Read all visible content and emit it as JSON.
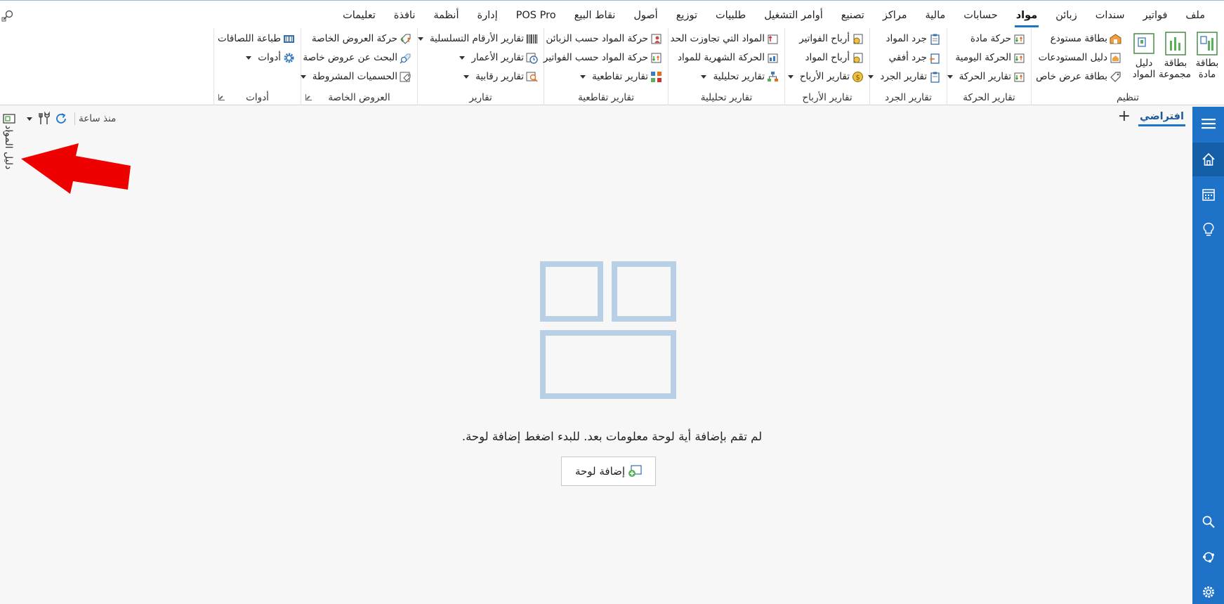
{
  "menu": {
    "items": [
      "ملف",
      "فواتير",
      "سندات",
      "زبائن",
      "مواد",
      "حسابات",
      "مالية",
      "مراكز",
      "تصنيع",
      "أوامر التشغيل",
      "طلبيات",
      "توزيع",
      "أصول",
      "نقاط البيع",
      "POS Pro",
      "إدارة",
      "أنظمة",
      "نافذة",
      "تعليمات"
    ],
    "active": "مواد"
  },
  "ribbon": {
    "setup": {
      "label": "تنظيم",
      "item_card": "بطاقة مادة",
      "group_card": "بطاقة مجموعة",
      "items_guide": "دليل المواد",
      "warehouse_card": "بطاقة مستودع",
      "warehouses_guide": "دليل المستودعات",
      "special_offer_card": "بطاقة عرض خاص"
    },
    "movement": {
      "label": "تقارير الحركة",
      "item_movement": "حركة مادة",
      "daily_movement": "الحركة اليومية",
      "movement_reports": "تقارير الحركة"
    },
    "inventory": {
      "label": "تقارير الجرد",
      "items_inventory": "جرد المواد",
      "horizontal_inventory": "جرد أفقي",
      "inventory_reports": "تقارير الجرد"
    },
    "profits": {
      "label": "تقارير الأرباح",
      "invoice_profits": "أرباح الفواتير",
      "item_profits": "أرباح المواد",
      "profit_reports": "تقارير الأرباح"
    },
    "analytic": {
      "label": "تقارير تحليلية",
      "over_limit": "المواد التي تجاوزت الحد",
      "monthly_movement": "الحركة الشهرية للمواد",
      "analytic_reports": "تقارير تحليلية"
    },
    "cross": {
      "label": "تقارير تقاطعية",
      "by_customers": "حركة المواد حسب الزبائن",
      "by_invoices": "حركة المواد حسب الفواتير",
      "cross_reports": "تقارير تقاطعية"
    },
    "reports": {
      "label": "تقارير",
      "serials": "تقارير الأرقام التسلسلية",
      "ages": "تقارير الأعمار",
      "control": "تقارير رقابية"
    },
    "offers": {
      "label": "العروض  الخاصة",
      "offers_movement": "حركة العروض الخاصة",
      "search_offers": "البحث عن عروض خاصة",
      "conditional_discounts": "الحسميات المشروطة"
    },
    "tools": {
      "label": "أدوات",
      "print_labels": "طباعة اللصاقات",
      "tools": "أدوات"
    }
  },
  "tabs": {
    "default_tab": "افتراضي",
    "add": "+"
  },
  "toolbar": {
    "since": "منذ ساعة"
  },
  "left_panel": {
    "label": "دليل المواد"
  },
  "empty_state": {
    "message": "لم تقم بإضافة أية لوحة معلومات بعد. للبدء اضغط إضافة لوحة.",
    "add_button": "إضافة لوحة"
  },
  "colors": {
    "accent": "#1e73c8",
    "sidebar": "#1e73c8",
    "placeholder_graphic": "#b7d0e6",
    "annotation_arrow": "#ee0000"
  }
}
